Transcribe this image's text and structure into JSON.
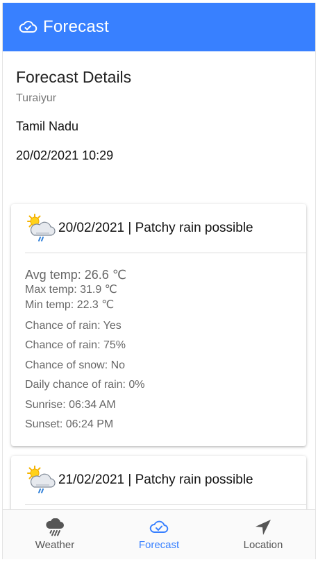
{
  "header": {
    "title": "Forecast",
    "icon": "cloud-icon"
  },
  "details": {
    "heading": "Forecast Details",
    "city": "Turaiyur",
    "state": "Tamil Nadu",
    "datetime": "20/02/2021 10:29"
  },
  "forecasts": [
    {
      "title": "20/02/2021 | Patchy rain possible",
      "icon": "patchy-rain-icon",
      "avg": "Avg temp: 26.6 ℃",
      "max": "Max temp: 31.9 ℃",
      "min": "Min temp: 22.3 ℃",
      "rain_yes": "Chance of rain: Yes",
      "rain_pct": "Chance of rain: 75%",
      "snow": "Chance of snow: No",
      "daily_rain": "Daily chance of rain: 0%",
      "sunrise": "Sunrise: 06:34 AM",
      "sunset": "Sunset: 06:24 PM"
    },
    {
      "title": "21/02/2021 | Patchy rain possible",
      "icon": "patchy-rain-icon"
    }
  ],
  "tabs": [
    {
      "label": "Weather",
      "icon": "rain-cloud-icon",
      "active": false
    },
    {
      "label": "Forecast",
      "icon": "cloud-icon",
      "active": true
    },
    {
      "label": "Location",
      "icon": "navigate-arrow-icon",
      "active": false
    }
  ],
  "colors": {
    "primary": "#3880ff",
    "text_muted": "#666666"
  }
}
